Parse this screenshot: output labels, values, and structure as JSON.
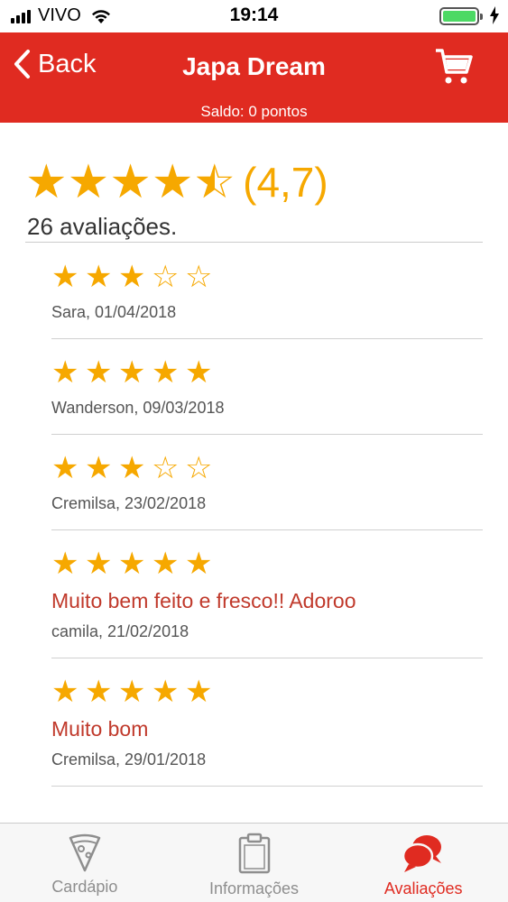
{
  "status_bar": {
    "carrier": "VIVO",
    "time": "19:14"
  },
  "navbar": {
    "back_label": "Back",
    "title": "Japa Dream",
    "subtitle": "Saldo: 0 pontos"
  },
  "summary": {
    "rating": 4.7,
    "average_text": "(4,7)",
    "count_text": "26 avaliações."
  },
  "reviews": [
    {
      "rating": 3,
      "comment": "",
      "author": "Sara, 01/04/2018"
    },
    {
      "rating": 5,
      "comment": "",
      "author": "Wanderson, 09/03/2018"
    },
    {
      "rating": 3,
      "comment": "",
      "author": "Cremilsa, 23/02/2018"
    },
    {
      "rating": 5,
      "comment": "Muito bem feito e fresco!! Adoroo",
      "author": "camila, 21/02/2018"
    },
    {
      "rating": 5,
      "comment": "Muito bom",
      "author": "Cremilsa, 29/01/2018"
    }
  ],
  "tabs": [
    {
      "label": "Cardápio",
      "icon": "pizza-slice-icon",
      "active": false
    },
    {
      "label": "Informações",
      "icon": "clipboard-icon",
      "active": false
    },
    {
      "label": "Avaliações",
      "icon": "chat-bubbles-icon",
      "active": true
    }
  ],
  "colors": {
    "accent": "#e02b21",
    "star": "#f6a800",
    "comment": "#c0392b"
  }
}
